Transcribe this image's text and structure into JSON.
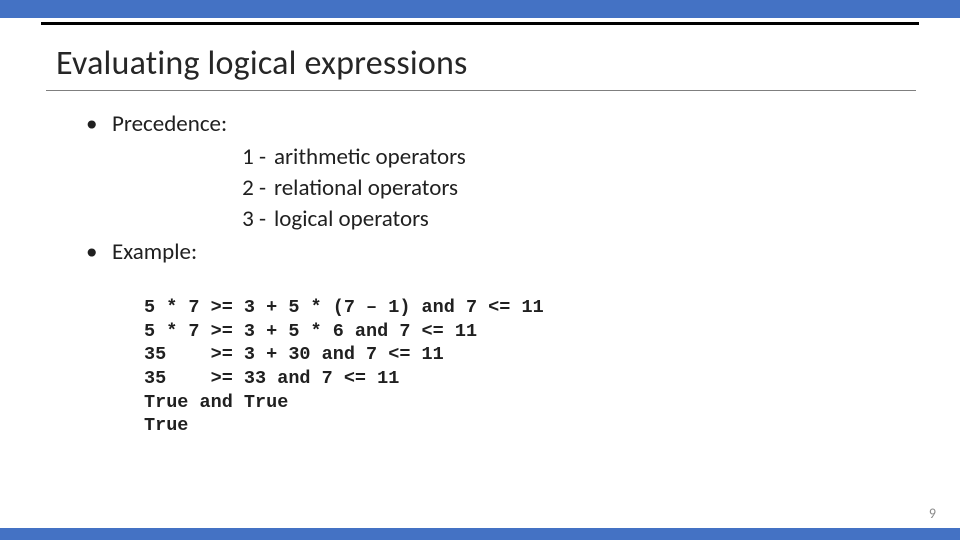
{
  "colors": {
    "accent": "#4472C4"
  },
  "title": "Evaluating logical expressions",
  "bullet_glyph": "•",
  "sections": {
    "precedence": {
      "label": "Precedence:",
      "items": [
        {
          "num": "1 -",
          "text": "arithmetic operators"
        },
        {
          "num": "2 -",
          "text": "relational operators"
        },
        {
          "num": "3 -",
          "text": "logical operators"
        }
      ]
    },
    "example": {
      "label": "Example:",
      "lines": [
        "5 * 7 >= 3 + 5 * (7 – 1) and 7 <= 11",
        "5 * 7 >= 3 + 5 * 6 and 7 <= 11",
        "35    >= 3 + 30 and 7 <= 11",
        "35    >= 33 and 7 <= 11",
        "True and True",
        "True"
      ]
    }
  },
  "page_number": "9"
}
